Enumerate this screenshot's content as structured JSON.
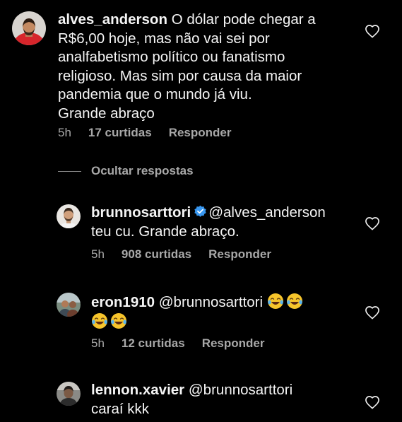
{
  "comments": [
    {
      "username": "alves_anderson",
      "lines": [
        "O dólar pode chegar a",
        "R$6,00 hoje, mas não vai sei por",
        "analfabetismo político ou fanatismo",
        "religioso. Mas sim por causa da maior",
        "pandemia que o mundo já viu.",
        "Grande abraço"
      ],
      "time": "5h",
      "likes": "17 curtidas",
      "reply": "Responder"
    }
  ],
  "hide_replies": "Ocultar respostas",
  "replies": [
    {
      "username": "brunnosarttori",
      "verified": true,
      "text_line1": "@alves_anderson",
      "text_line2": "teu cu. Grande abraço.",
      "time": "5h",
      "likes": "908 curtidas",
      "reply": "Responder"
    },
    {
      "username": "eron1910",
      "text_line1": "@brunnosarttori",
      "emoji": "😂",
      "time": "5h",
      "likes": "12 curtidas",
      "reply": "Responder"
    },
    {
      "username": "lennon.xavier",
      "text_line1": "@brunnosarttori",
      "text_line2": "caraí kkk"
    }
  ],
  "icons": {
    "like": "heart-outline-icon",
    "verified": "verified-badge-icon"
  },
  "colors": {
    "background": "#000000",
    "text": "#f5f5f5",
    "secondary": "#a8a8a8",
    "verified": "#3897f0"
  }
}
